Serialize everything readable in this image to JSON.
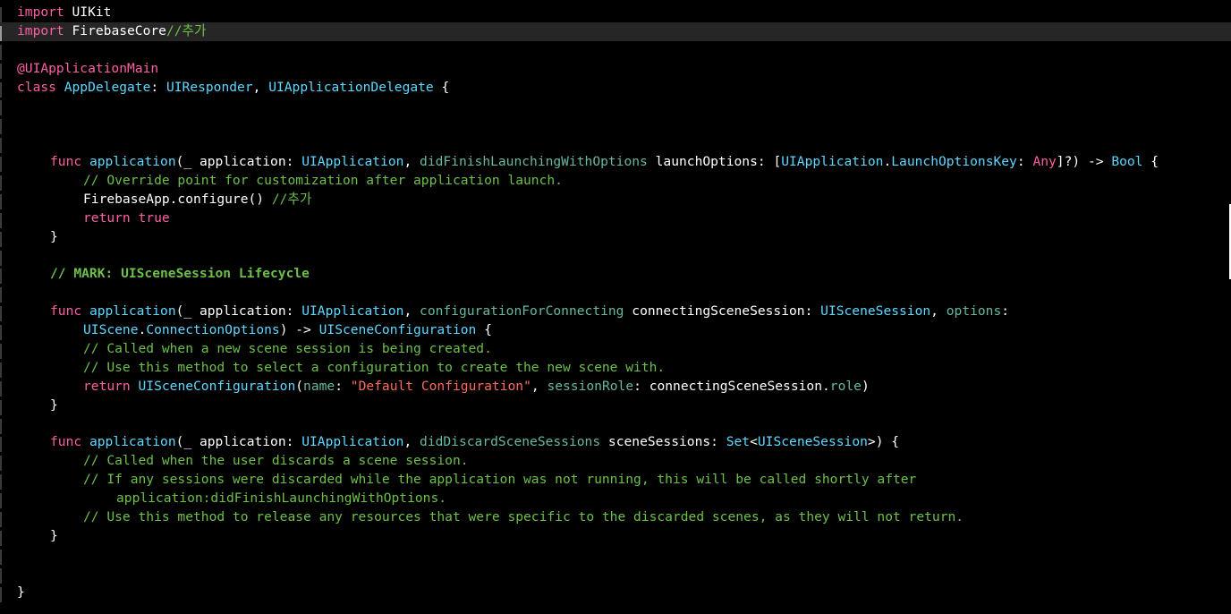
{
  "editor": {
    "lines": [
      {
        "indent": 0,
        "tokens": [
          [
            "kw",
            "import"
          ],
          [
            "pun",
            " "
          ],
          [
            "plain",
            "UIKit"
          ]
        ]
      },
      {
        "indent": 0,
        "current": true,
        "tokens": [
          [
            "kw",
            "import"
          ],
          [
            "pun",
            " "
          ],
          [
            "plain",
            "FirebaseCore"
          ],
          [
            "cmt",
            "//추가"
          ]
        ]
      },
      {
        "indent": 0,
        "tokens": []
      },
      {
        "indent": 0,
        "tokens": [
          [
            "kw",
            "@UIApplicationMain"
          ]
        ]
      },
      {
        "indent": 0,
        "tokens": [
          [
            "kw",
            "class"
          ],
          [
            "pun",
            " "
          ],
          [
            "dfn",
            "AppDelegate"
          ],
          [
            "pun",
            ": "
          ],
          [
            "cls",
            "UIResponder"
          ],
          [
            "pun",
            ", "
          ],
          [
            "cls",
            "UIApplicationDelegate"
          ],
          [
            "pun",
            " {"
          ]
        ]
      },
      {
        "indent": 0,
        "tokens": []
      },
      {
        "indent": 0,
        "tokens": []
      },
      {
        "indent": 0,
        "tokens": []
      },
      {
        "indent": 1,
        "tokens": [
          [
            "kw",
            "func"
          ],
          [
            "pun",
            " "
          ],
          [
            "dfn",
            "application"
          ],
          [
            "pun",
            "("
          ],
          [
            "plain",
            "_ application"
          ],
          [
            "pun",
            ": "
          ],
          [
            "cls",
            "UIApplication"
          ],
          [
            "pun",
            ", "
          ],
          [
            "fn",
            "didFinishLaunchingWithOptions"
          ],
          [
            "pun",
            " "
          ],
          [
            "plain",
            "launchOptions"
          ],
          [
            "pun",
            ": ["
          ],
          [
            "cls",
            "UIApplication"
          ],
          [
            "pun",
            "."
          ],
          [
            "cls",
            "LaunchOptionsKey"
          ],
          [
            "pun",
            ": "
          ],
          [
            "kw",
            "Any"
          ],
          [
            "pun",
            "]?) -> "
          ],
          [
            "cls",
            "Bool"
          ],
          [
            "pun",
            " {"
          ]
        ]
      },
      {
        "indent": 2,
        "tokens": [
          [
            "cmt",
            "// Override point for customization after application launch."
          ]
        ]
      },
      {
        "indent": 2,
        "tokens": [
          [
            "plain",
            "FirebaseApp.configure() "
          ],
          [
            "cmt",
            "//추가"
          ]
        ]
      },
      {
        "indent": 2,
        "tokens": [
          [
            "kw",
            "return"
          ],
          [
            "pun",
            " "
          ],
          [
            "kw",
            "true"
          ]
        ]
      },
      {
        "indent": 1,
        "tokens": [
          [
            "pun",
            "}"
          ]
        ]
      },
      {
        "indent": 0,
        "tokens": []
      },
      {
        "indent": 1,
        "tokens": [
          [
            "mark",
            "// MARK: UISceneSession Lifecycle"
          ]
        ]
      },
      {
        "indent": 0,
        "tokens": []
      },
      {
        "indent": 1,
        "tokens": [
          [
            "kw",
            "func"
          ],
          [
            "pun",
            " "
          ],
          [
            "dfn",
            "application"
          ],
          [
            "pun",
            "("
          ],
          [
            "plain",
            "_ application"
          ],
          [
            "pun",
            ": "
          ],
          [
            "cls",
            "UIApplication"
          ],
          [
            "pun",
            ", "
          ],
          [
            "fn",
            "configurationForConnecting"
          ],
          [
            "pun",
            " "
          ],
          [
            "plain",
            "connectingSceneSession"
          ],
          [
            "pun",
            ": "
          ],
          [
            "cls",
            "UISceneSession"
          ],
          [
            "pun",
            ", "
          ],
          [
            "fn",
            "options"
          ],
          [
            "pun",
            ":"
          ]
        ]
      },
      {
        "indent": 2,
        "tokens": [
          [
            "cls",
            "UIScene"
          ],
          [
            "pun",
            "."
          ],
          [
            "cls",
            "ConnectionOptions"
          ],
          [
            "pun",
            ") -> "
          ],
          [
            "cls",
            "UISceneConfiguration"
          ],
          [
            "pun",
            " {"
          ]
        ]
      },
      {
        "indent": 2,
        "tokens": [
          [
            "cmt",
            "// Called when a new scene session is being created."
          ]
        ]
      },
      {
        "indent": 2,
        "tokens": [
          [
            "cmt",
            "// Use this method to select a configuration to create the new scene with."
          ]
        ]
      },
      {
        "indent": 2,
        "tokens": [
          [
            "kw",
            "return"
          ],
          [
            "pun",
            " "
          ],
          [
            "cls",
            "UISceneConfiguration"
          ],
          [
            "pun",
            "("
          ],
          [
            "fn",
            "name"
          ],
          [
            "pun",
            ": "
          ],
          [
            "str",
            "\"Default Configuration\""
          ],
          [
            "pun",
            ", "
          ],
          [
            "fn",
            "sessionRole"
          ],
          [
            "pun",
            ": "
          ],
          [
            "plain",
            "connectingSceneSession"
          ],
          [
            "pun",
            "."
          ],
          [
            "fn",
            "role"
          ],
          [
            "pun",
            ")"
          ]
        ]
      },
      {
        "indent": 1,
        "tokens": [
          [
            "pun",
            "}"
          ]
        ]
      },
      {
        "indent": 0,
        "tokens": []
      },
      {
        "indent": 1,
        "tokens": [
          [
            "kw",
            "func"
          ],
          [
            "pun",
            " "
          ],
          [
            "dfn",
            "application"
          ],
          [
            "pun",
            "("
          ],
          [
            "plain",
            "_ application"
          ],
          [
            "pun",
            ": "
          ],
          [
            "cls",
            "UIApplication"
          ],
          [
            "pun",
            ", "
          ],
          [
            "fn",
            "didDiscardSceneSessions"
          ],
          [
            "pun",
            " "
          ],
          [
            "plain",
            "sceneSessions"
          ],
          [
            "pun",
            ": "
          ],
          [
            "cls",
            "Set"
          ],
          [
            "pun",
            "<"
          ],
          [
            "cls",
            "UISceneSession"
          ],
          [
            "pun",
            ">) {"
          ]
        ]
      },
      {
        "indent": 2,
        "tokens": [
          [
            "cmt",
            "// Called when the user discards a scene session."
          ]
        ]
      },
      {
        "indent": 2,
        "tokens": [
          [
            "cmt",
            "// If any sessions were discarded while the application was not running, this will be called shortly after"
          ]
        ]
      },
      {
        "indent": 3,
        "tokens": [
          [
            "cmt",
            "application:didFinishLaunchingWithOptions."
          ]
        ]
      },
      {
        "indent": 2,
        "tokens": [
          [
            "cmt",
            "// Use this method to release any resources that were specific to the discarded scenes, as they will not return."
          ]
        ]
      },
      {
        "indent": 1,
        "tokens": [
          [
            "pun",
            "}"
          ]
        ]
      },
      {
        "indent": 0,
        "tokens": []
      },
      {
        "indent": 0,
        "tokens": []
      },
      {
        "indent": 0,
        "tokens": [
          [
            "pun",
            "}"
          ]
        ]
      }
    ]
  }
}
